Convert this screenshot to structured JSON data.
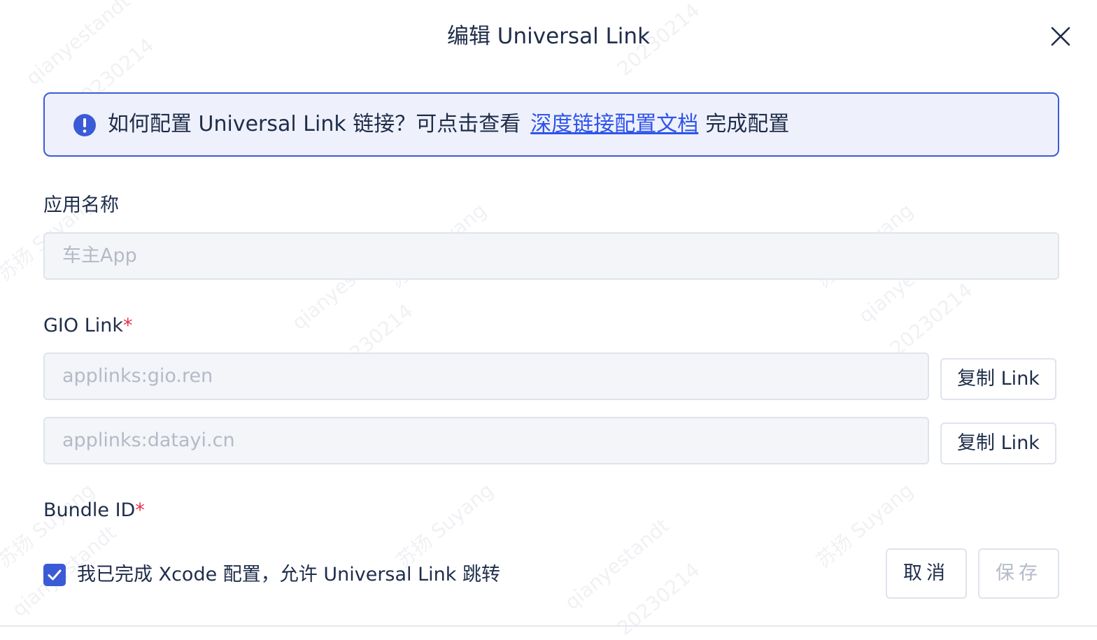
{
  "dialog": {
    "title": "编辑 Universal Link",
    "close_icon": "close-icon"
  },
  "alert": {
    "icon": "exclamation-circle-icon",
    "text_before": "如何配置 Universal Link 链接？可点击查看",
    "link_text": "深度链接配置文档",
    "text_after": "完成配置"
  },
  "app_name": {
    "label": "应用名称",
    "value": "车主App"
  },
  "gio_link": {
    "label": "GIO Link",
    "required_mark": "*",
    "links": [
      {
        "value": "applinks:gio.ren",
        "copy_label": "复制 Link"
      },
      {
        "value": "applinks:datayi.cn",
        "copy_label": "复制 Link"
      }
    ]
  },
  "bundle_id": {
    "label": "Bundle ID",
    "required_mark": "*"
  },
  "confirm": {
    "checked": true,
    "label": "我已完成 Xcode 配置，允许 Universal Link 跳转"
  },
  "footer": {
    "cancel_label": "取消",
    "save_label": "保存"
  },
  "watermark": {
    "texts": [
      "qianyestandt",
      "20230214",
      "苏扬 Suyang"
    ]
  },
  "colors": {
    "primary": "#3b5bd6",
    "link": "#2f54eb",
    "required": "#e5304f",
    "text": "#1f2d4a",
    "placeholder": "#b4bac6"
  }
}
